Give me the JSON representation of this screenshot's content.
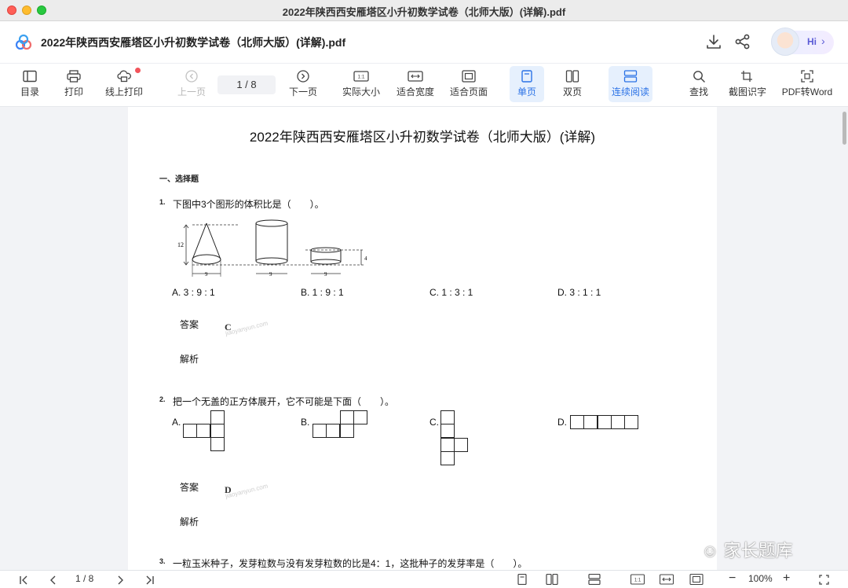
{
  "window": {
    "title": "2022年陕西西安雁塔区小升初数学试卷（北师大版）(详解).pdf"
  },
  "header": {
    "doc_title": "2022年陕西西安雁塔区小升初数学试卷（北师大版）(详解).pdf",
    "icons": [
      "download-icon",
      "share-icon"
    ],
    "assistant": {
      "label": "Hi",
      "chevron": "›"
    }
  },
  "toolbar": {
    "toc": "目录",
    "print": "打印",
    "online_print": "线上打印",
    "prev_page": "上一页",
    "page_indicator": "1  /  8",
    "next_page": "下一页",
    "actual_size": "实际大小",
    "fit_width": "适合宽度",
    "fit_page": "适合页面",
    "single_page": "单页",
    "double_page": "双页",
    "continuous": "连续阅读",
    "find": "查找",
    "ocr": "截图识字",
    "pdf_to_word": "PDF转Word",
    "icon_labels": {
      "actual_size": "1:1"
    },
    "active": [
      "单页",
      "连续阅读"
    ]
  },
  "document": {
    "title": "2022年陕西西安雁塔区小升初数学试卷（北师大版）(详解)",
    "section": "一、选择题",
    "questions": [
      {
        "number": "1.",
        "text": "下图中3个图形的体积比是（　　）。",
        "figure_labels": {
          "cone_height": "12",
          "cone_base": "9",
          "cylinder_base": "9",
          "short_cylinder_base": "9",
          "short_cylinder_height": "4"
        },
        "options": [
          "A. 3 : 9 : 1",
          "B. 1 : 9 : 1",
          "C. 1 : 3 : 1",
          "D. 3 : 1 : 1"
        ],
        "answer_label": "答案",
        "answer": "C",
        "analysis_label": "解析"
      },
      {
        "number": "2.",
        "text": "把一个无盖的正方体展开，它不可能是下面（　　）。",
        "options": [
          "A.",
          "B.",
          "C.",
          "D."
        ],
        "answer_label": "答案",
        "answer": "D",
        "analysis_label": "解析"
      },
      {
        "number": "3.",
        "text": "一粒玉米种子，发芽粒数与没有发芽粒数的比是4：1，这批种子的发芽率是（　　）。"
      }
    ],
    "watermark": "jiaoyanyun.com",
    "overlay_watermark": "家长题库"
  },
  "bottom_bar": {
    "page_indicator": "1 / 8",
    "actual_size_label": "1:1",
    "zoom": "100%",
    "zoom_out": "−",
    "zoom_in": "+"
  },
  "colors": {
    "accent": "#2b72e6",
    "active_bg": "#e6f0fd",
    "badge": "#f2545b"
  }
}
